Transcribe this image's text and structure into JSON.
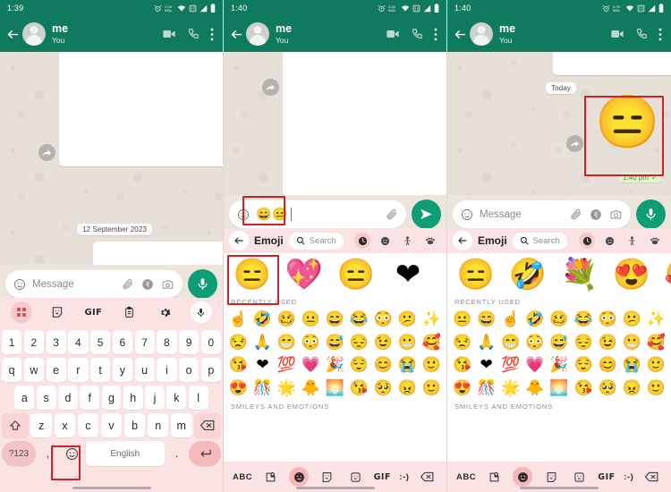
{
  "app": {
    "name": "WhatsApp",
    "accent": "#0f7a5e",
    "send_accent": "#0f9d76",
    "keyboard_bg": "#fbe3e4",
    "highlight": "#d32027"
  },
  "panels": [
    {
      "id": "panel-1",
      "status": {
        "time": "1:39",
        "icons": [
          "alarm-icon",
          "data-speed-icon",
          "wifi-icon",
          "sim-icon",
          "signal-icon",
          "battery-icon"
        ]
      },
      "appbar": {
        "contact": "me",
        "subtitle": "You",
        "actions": [
          "video-call-icon",
          "voice-call-icon",
          "overflow-menu-icon"
        ]
      },
      "chat": {
        "date_chip": "12 September 2023",
        "bubbles": 2,
        "forward_icon": "forward-arrow-icon"
      },
      "input": {
        "placeholder": "Message",
        "value": "",
        "icons": [
          "emoji-icon",
          "attach-icon",
          "payment-icon",
          "camera-icon"
        ],
        "fab": "mic-icon"
      },
      "keyboard_toolbar": [
        "apps-grid-icon",
        "sticker-icon",
        "GIF",
        "clipboard-icon",
        "settings-icon",
        "mic-icon"
      ],
      "keyboard": {
        "rows": [
          [
            "1",
            "2",
            "3",
            "4",
            "5",
            "6",
            "7",
            "8",
            "9",
            "0"
          ],
          [
            "q",
            "w",
            "e",
            "r",
            "t",
            "y",
            "u",
            "i",
            "o",
            "p"
          ],
          [
            "a",
            "s",
            "d",
            "f",
            "g",
            "h",
            "j",
            "k",
            "l"
          ],
          [
            "z",
            "x",
            "c",
            "v",
            "b",
            "n",
            "m"
          ]
        ],
        "shift": "shift-icon",
        "backspace": "backspace-icon",
        "mode": "?123",
        "comma": ",",
        "emoji": "emoji-key-icon",
        "space": "English",
        "period": ".",
        "enter": "enter-icon"
      },
      "highlight": {
        "target": "emoji-key-icon"
      }
    },
    {
      "id": "panel-2",
      "status": {
        "time": "1:40",
        "icons": [
          "alarm-icon",
          "data-speed-icon",
          "wifi-icon",
          "sim-icon",
          "signal-icon",
          "battery-icon"
        ]
      },
      "appbar": {
        "contact": "me",
        "subtitle": "You",
        "actions": [
          "video-call-icon",
          "voice-call-icon",
          "overflow-menu-icon"
        ]
      },
      "chat": {
        "date_chip": "",
        "bubbles": 1,
        "forward_icon": "forward-arrow-icon"
      },
      "input": {
        "placeholder": "",
        "value": "😄😐",
        "icons": [
          "emoji-icon",
          "attach-icon"
        ],
        "fab": "send-icon"
      },
      "emoji_picker": {
        "back": "back-arrow-icon",
        "title": "Emoji",
        "search_placeholder": "Search",
        "search_icon": "search-icon",
        "categories": [
          "clock-icon",
          "smiley-icon",
          "person-icon",
          "animal-icon"
        ],
        "selected_category": "clock-icon",
        "variants": [
          "😑",
          "💖",
          "😑",
          "❤"
        ],
        "section_label": "RECENTLY USED",
        "section_label_2": "SMILEYS AND EMOTIONS",
        "recent": [
          "☝",
          "🤣",
          "🥴",
          "😐",
          "😄",
          "😂",
          "😳",
          "😕",
          "✨",
          "😒",
          "🙏",
          "😁",
          "😳",
          "😅",
          "😔",
          "😉",
          "😬",
          "🥰",
          "😘",
          "❤",
          "💯",
          "💗",
          "🎉",
          "😌",
          "😊",
          "😭",
          "🙂",
          "😍",
          "🎊",
          "🌟",
          "🐥",
          "🌅",
          "😘",
          "🥺",
          "😠",
          "🙂"
        ],
        "bottom_bar": [
          "ABC",
          "sticker-search-icon",
          "emoji-icon",
          "sticker-icon",
          "avatar-sticker-icon",
          "GIF",
          ":-)",
          "backspace-icon"
        ],
        "bottom_selected": "emoji-icon"
      },
      "highlights": [
        {
          "target": "typed-emoji"
        },
        {
          "target": "variant-emoji-first"
        }
      ]
    },
    {
      "id": "panel-3",
      "status": {
        "time": "1:40",
        "icons": [
          "alarm-icon",
          "data-speed-icon",
          "wifi-icon",
          "sim-icon",
          "signal-icon",
          "battery-icon"
        ]
      },
      "appbar": {
        "contact": "me",
        "subtitle": "You",
        "actions": [
          "video-call-icon",
          "voice-call-icon",
          "overflow-menu-icon"
        ]
      },
      "chat": {
        "date_chip": "Today",
        "sent_emoji": "😑",
        "timestamp": "1:40 pm",
        "tick": "✓",
        "forward_icon": "forward-arrow-icon"
      },
      "input": {
        "placeholder": "Message",
        "value": "",
        "icons": [
          "emoji-icon",
          "attach-icon",
          "payment-icon",
          "camera-icon"
        ],
        "fab": "mic-icon"
      },
      "emoji_picker": {
        "back": "back-arrow-icon",
        "title": "Emoji",
        "search_placeholder": "Search",
        "search_icon": "search-icon",
        "categories": [
          "clock-icon",
          "smiley-icon",
          "person-icon",
          "animal-icon"
        ],
        "selected_category": "clock-icon",
        "variants": [
          "😑",
          "🤣",
          "💐",
          "😍",
          "🥰"
        ],
        "section_label": "RECENTLY USED",
        "section_label_2": "SMILEYS AND EMOTIONS",
        "recent": [
          "😐",
          "😄",
          "☝",
          "🤣",
          "🥴",
          "😂",
          "😳",
          "😕",
          "✨",
          "😒",
          "🙏",
          "😁",
          "😳",
          "😅",
          "😔",
          "😉",
          "😬",
          "🥰",
          "😘",
          "❤",
          "💯",
          "💗",
          "🎉",
          "😌",
          "😊",
          "😭",
          "🙂",
          "😍",
          "🎊",
          "🌟",
          "🐥",
          "🌅",
          "😘",
          "🥺",
          "😠",
          "🙂"
        ],
        "bottom_bar": [
          "ABC",
          "sticker-search-icon",
          "emoji-icon",
          "sticker-icon",
          "avatar-sticker-icon",
          "GIF",
          ":-)",
          "backspace-icon"
        ],
        "bottom_selected": "emoji-icon"
      },
      "highlight": {
        "target": "sent-emoji-bubble"
      }
    }
  ]
}
